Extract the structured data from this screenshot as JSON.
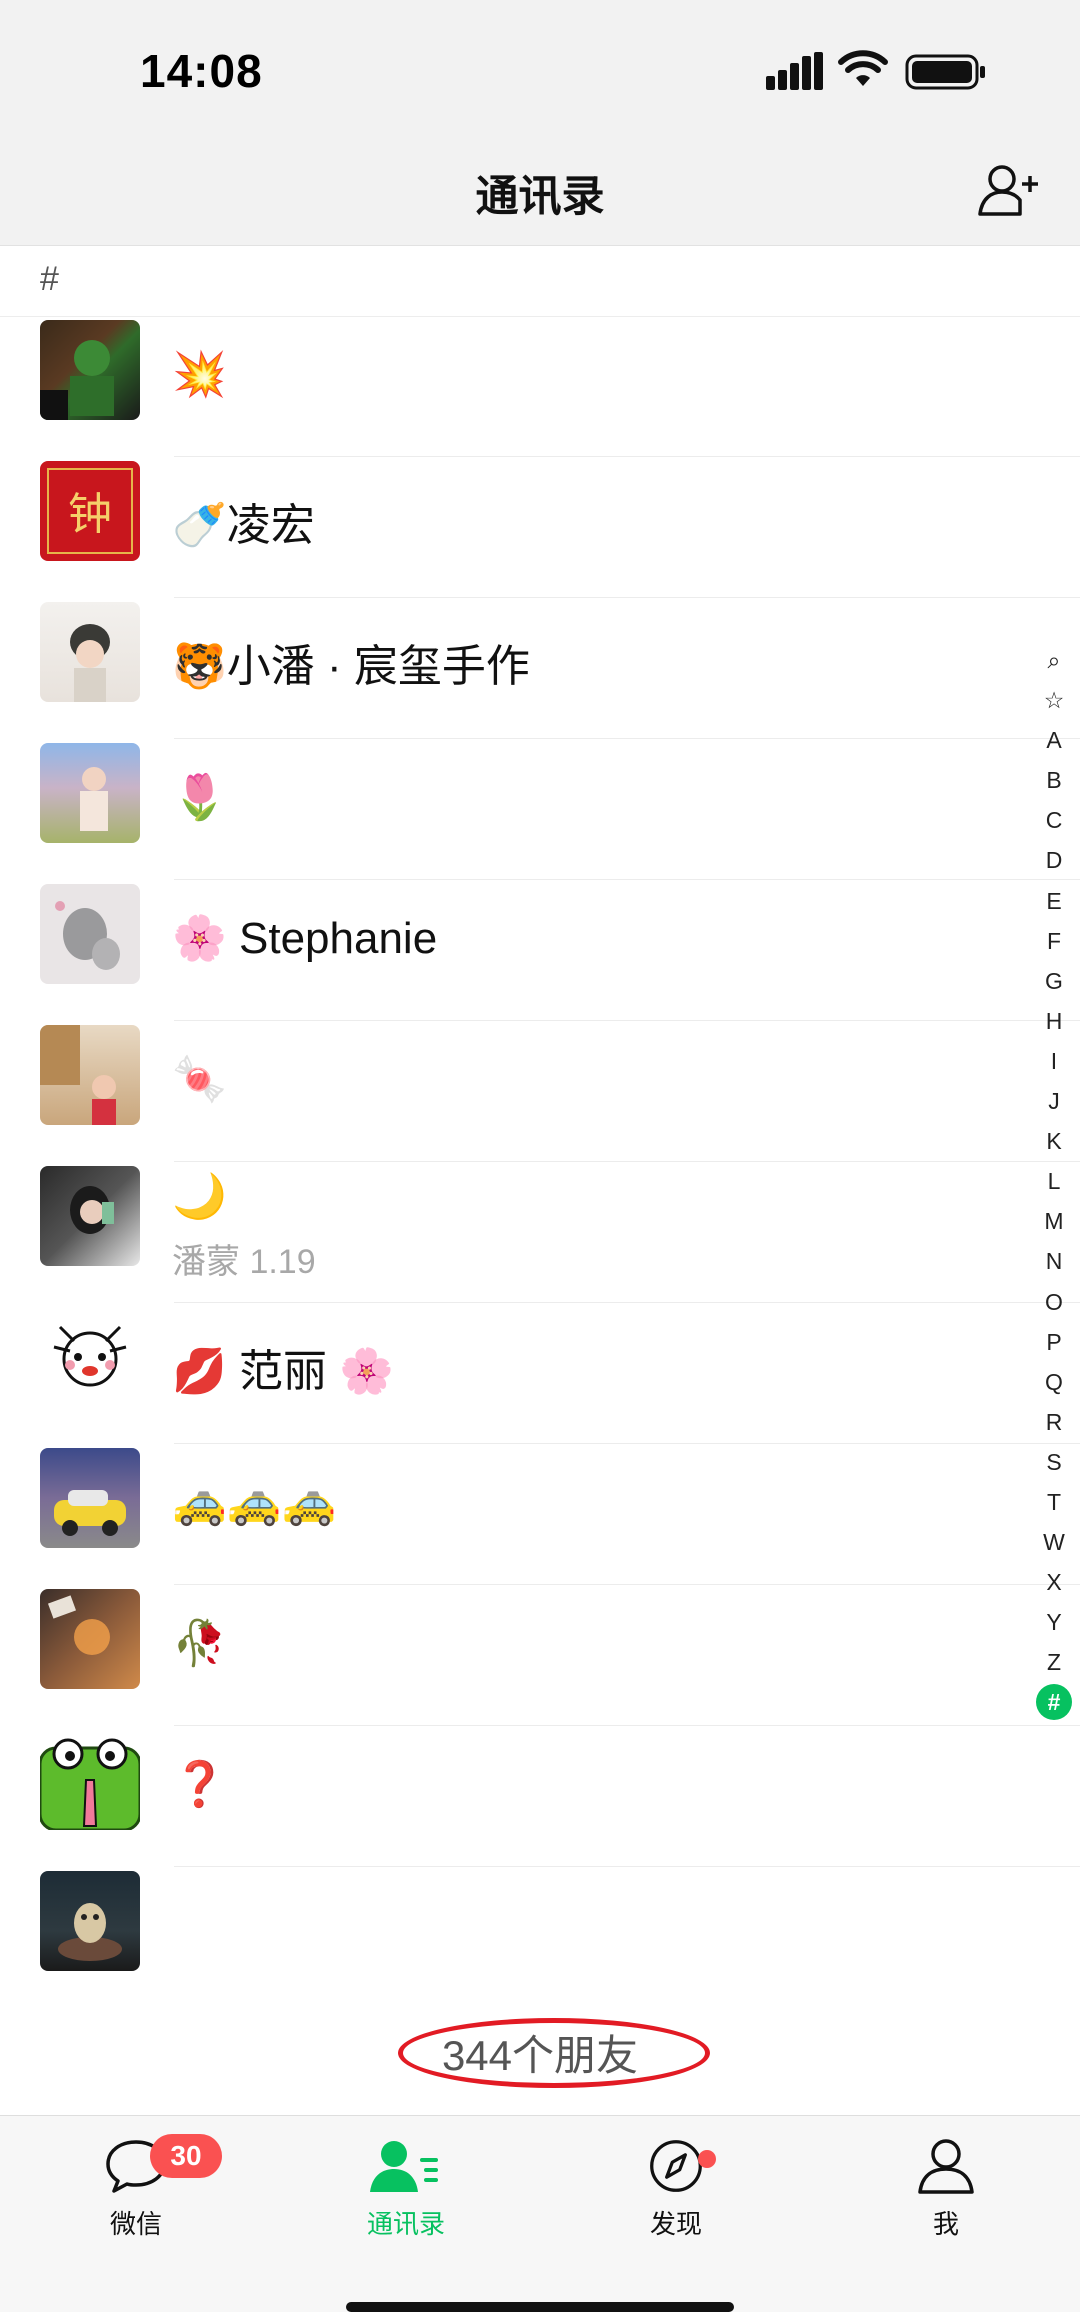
{
  "status_bar": {
    "time": "14:08"
  },
  "header": {
    "title": "通讯录"
  },
  "section": {
    "letter": "#"
  },
  "contacts": [
    {
      "name": "💥",
      "sub": ""
    },
    {
      "name": "🍼凌宏",
      "sub": ""
    },
    {
      "name": "🐯小潘 · 宸玺手作",
      "sub": ""
    },
    {
      "name": "🌷",
      "sub": ""
    },
    {
      "name": "🌸 Stephanie",
      "sub": ""
    },
    {
      "name": "🍬",
      "sub": ""
    },
    {
      "name": "🌙",
      "sub": "潘蒙 1.19"
    },
    {
      "name": "💋  范丽  🌸",
      "sub": ""
    },
    {
      "name": "🚕🚕🚕",
      "sub": ""
    },
    {
      "name": "🥀",
      "sub": ""
    },
    {
      "name": "❓",
      "sub": ""
    },
    {
      "name": "",
      "sub": ""
    }
  ],
  "friend_count": "344个朋友",
  "index_letters": [
    "⌕",
    "☆",
    "A",
    "B",
    "C",
    "D",
    "E",
    "F",
    "G",
    "H",
    "I",
    "J",
    "K",
    "L",
    "M",
    "N",
    "O",
    "P",
    "Q",
    "R",
    "S",
    "T",
    "W",
    "X",
    "Y",
    "Z",
    "#"
  ],
  "tabs": {
    "chats": {
      "label": "微信",
      "badge": "30"
    },
    "contacts": {
      "label": "通讯录"
    },
    "discover": {
      "label": "发现"
    },
    "me": {
      "label": "我"
    }
  },
  "colors": {
    "accent": "#07c160",
    "badge": "#fa5151",
    "annotation": "#e21b24"
  }
}
